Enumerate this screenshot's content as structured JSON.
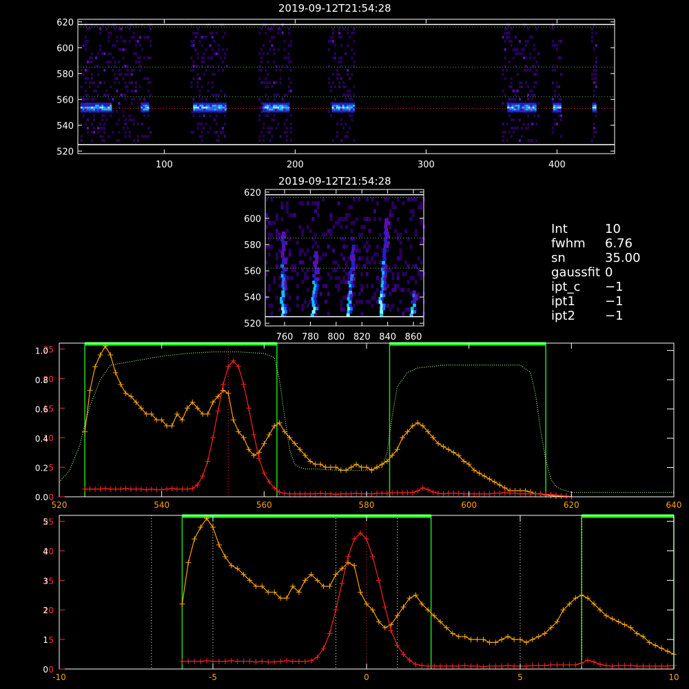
{
  "top_panel": {
    "title": "2019-09-12T21:54:28",
    "x_ticks": [
      100,
      200,
      300,
      400
    ],
    "y_ticks": [
      520,
      540,
      560,
      580,
      600,
      620
    ],
    "xlim": [
      34,
      444
    ],
    "ylim": [
      518,
      622
    ],
    "white_lines_y": [
      525,
      618
    ],
    "dotted_green_y": [
      562,
      585,
      616
    ],
    "dotted_red_y": [
      553
    ],
    "bright_row_y": 553,
    "stripes": [
      [
        36,
        90
      ],
      [
        120,
        148
      ],
      [
        172,
        196
      ],
      [
        225,
        245
      ],
      [
        358,
        386
      ],
      [
        396,
        403
      ],
      [
        426,
        430
      ]
    ],
    "bright_stripes": [
      [
        36,
        60
      ],
      [
        82,
        88
      ],
      [
        122,
        146
      ],
      [
        175,
        195
      ],
      [
        228,
        244
      ],
      [
        362,
        384
      ],
      [
        397,
        402
      ],
      [
        427,
        430
      ]
    ]
  },
  "zoom_panel": {
    "title": "2019-09-12T21:54:28",
    "x_ticks": [
      760,
      780,
      800,
      820,
      840,
      860
    ],
    "y_ticks": [
      520,
      540,
      560,
      580,
      600,
      620
    ],
    "xlim": [
      745,
      868
    ],
    "ylim": [
      518,
      622
    ],
    "white_lines_y": [
      525,
      618
    ],
    "dotted_green_y": [
      562,
      585,
      616
    ],
    "streaks": [
      [
        757,
        525,
        758,
        590
      ],
      [
        781,
        525,
        783,
        575
      ],
      [
        808,
        525,
        812,
        578
      ],
      [
        833,
        525,
        838,
        600
      ],
      [
        858,
        525,
        860,
        545
      ]
    ]
  },
  "info": [
    {
      "key": "Int",
      "value": "10"
    },
    {
      "key": "fwhm",
      "value": "6.76"
    },
    {
      "key": "sn",
      "value": "35.00"
    },
    {
      "key": "gaussfit",
      "value": "0"
    },
    {
      "key": "ipt_c",
      "value": "−1"
    },
    {
      "key": "ipt1",
      "value": "−1"
    },
    {
      "key": "ipt2",
      "value": "−1"
    }
  ],
  "chart_data": [
    {
      "type": "line",
      "xlim": [
        520,
        640
      ],
      "x_ticks": [
        520,
        540,
        560,
        580,
        600,
        620,
        640
      ],
      "left_red_axis": {
        "ylim": [
          0,
          26
        ],
        "ticks": [
          0,
          5,
          10,
          15,
          20,
          25
        ],
        "labels": [
          "0",
          "5",
          "10",
          "15",
          "20",
          "25"
        ]
      },
      "left_white_axis": {
        "ylim": [
          0,
          1.05
        ],
        "ticks": [
          0.0,
          0.2,
          0.4,
          0.6,
          0.8,
          1.0
        ],
        "labels": [
          "0.0",
          "0.2",
          "0.4",
          "0.6",
          "0.8",
          "1.0"
        ]
      },
      "green_windows": [
        [
          525,
          562.5
        ],
        [
          584.5,
          615
        ]
      ],
      "red_dotted_x": [
        553
      ],
      "series": [
        {
          "color": "#ffa500",
          "axis": "red",
          "x": [
            525,
            526,
            527,
            528,
            529,
            530,
            531,
            532,
            533,
            534,
            535,
            536,
            537,
            538,
            539,
            540,
            541,
            542,
            543,
            544,
            545,
            546,
            547,
            548,
            549,
            550,
            551,
            552,
            553,
            554,
            555,
            556,
            557,
            558,
            559,
            560,
            561,
            562,
            563,
            564,
            565,
            566,
            567,
            568,
            569,
            570,
            571,
            572,
            573,
            574,
            575,
            576,
            577,
            578,
            579,
            580,
            581,
            582,
            583,
            584,
            585,
            586,
            587,
            588,
            589,
            590,
            591,
            592,
            593,
            594,
            595,
            596,
            597,
            598,
            599,
            600,
            601,
            602,
            603,
            604,
            605,
            606,
            607,
            608,
            609,
            610,
            611,
            612,
            613,
            614,
            615,
            616,
            617,
            618,
            619,
            620
          ],
          "values": [
            11,
            18,
            22,
            24,
            25.5,
            24,
            21,
            19,
            17.5,
            17,
            16,
            15,
            14,
            14,
            13,
            13,
            12,
            12,
            14,
            13,
            15,
            16,
            15,
            14,
            14,
            16,
            17,
            18,
            17.5,
            13,
            11,
            10,
            8,
            7,
            7.5,
            9,
            10.5,
            12,
            12.5,
            11,
            10,
            9,
            8,
            7,
            6,
            5.5,
            5.5,
            5,
            5,
            5,
            4.5,
            4.5,
            5,
            5.5,
            5,
            5,
            4.5,
            5,
            5.5,
            6,
            7,
            8,
            10,
            11,
            12,
            12.5,
            12,
            11,
            10,
            9,
            8.5,
            8,
            7.5,
            7,
            6,
            5.5,
            4.5,
            4,
            3.5,
            3,
            2.5,
            2,
            1.5,
            1,
            1,
            1,
            1,
            0.8,
            0.5,
            0.5,
            0.3,
            0.2,
            0.1,
            0.1,
            0.1,
            0
          ]
        },
        {
          "color": "#ff2020",
          "axis": "red",
          "x": [
            525,
            526,
            527,
            528,
            529,
            530,
            531,
            532,
            533,
            534,
            535,
            536,
            537,
            538,
            539,
            540,
            541,
            542,
            543,
            544,
            545,
            546,
            547,
            548,
            549,
            550,
            551,
            552,
            553,
            554,
            555,
            556,
            557,
            558,
            559,
            560,
            561,
            562,
            563,
            564,
            565,
            566,
            567,
            568,
            569,
            570,
            571,
            572,
            573,
            574,
            575,
            576,
            577,
            578,
            579,
            580,
            581,
            582,
            583,
            584,
            585,
            586,
            587,
            588,
            589,
            590,
            591,
            592,
            593,
            594,
            595,
            596,
            597,
            598,
            599,
            600,
            601,
            602,
            603,
            604,
            605,
            606,
            607,
            608,
            609,
            610,
            611,
            612,
            613,
            614,
            615,
            616,
            617,
            618,
            619,
            620
          ],
          "values": [
            1.3,
            1.3,
            1.3,
            1.3,
            1.4,
            1.3,
            1.3,
            1.3,
            1.4,
            1.3,
            1.3,
            1.3,
            1.2,
            1.3,
            1.2,
            1.2,
            1.3,
            1.4,
            1.3,
            1.3,
            1.3,
            1.4,
            2,
            3.5,
            6,
            10,
            14.5,
            19,
            22,
            23,
            22,
            19,
            15,
            10.5,
            6.5,
            4,
            2.5,
            1.5,
            0.8,
            0.6,
            0.5,
            0.5,
            0.5,
            0.5,
            0.5,
            0.5,
            0.6,
            0.5,
            0.5,
            0.4,
            0.5,
            0.5,
            0.5,
            0.6,
            0.5,
            0.5,
            0.5,
            0.6,
            0.6,
            0.6,
            0.7,
            0.7,
            0.7,
            0.7,
            0.7,
            1,
            1.5,
            1.2,
            0.8,
            0.6,
            0.5,
            0.6,
            0.6,
            0.6,
            0.5,
            0.5,
            0.5,
            0.5,
            0.5,
            0.5,
            0.6,
            0.6,
            0.7,
            0.6,
            0.6,
            0.5,
            0.5,
            0.5,
            0.5,
            0.5,
            0.4,
            0.4,
            0.3,
            0.2,
            0.1,
            0
          ]
        },
        {
          "color": "#a8ff78",
          "axis": "white",
          "dotted": true,
          "x": [
            520,
            522,
            524,
            525,
            526,
            528,
            530,
            535,
            540,
            545,
            550,
            555,
            560,
            562,
            563,
            564,
            565,
            566,
            567,
            568,
            570,
            575,
            580,
            583,
            584,
            585,
            586,
            588,
            590,
            595,
            600,
            605,
            610,
            612,
            613,
            614,
            615,
            616,
            617,
            618,
            620,
            625,
            630,
            635,
            640
          ],
          "values": [
            0.1,
            0.18,
            0.35,
            0.5,
            0.62,
            0.8,
            0.9,
            0.93,
            0.96,
            0.98,
            0.99,
            0.99,
            0.98,
            0.95,
            0.8,
            0.55,
            0.32,
            0.22,
            0.2,
            0.19,
            0.19,
            0.18,
            0.18,
            0.2,
            0.3,
            0.55,
            0.75,
            0.85,
            0.88,
            0.9,
            0.9,
            0.9,
            0.9,
            0.85,
            0.7,
            0.45,
            0.25,
            0.12,
            0.07,
            0.05,
            0.03,
            0.03,
            0.03,
            0.03,
            0.03
          ]
        }
      ]
    },
    {
      "type": "line",
      "xlim": [
        -10,
        10
      ],
      "x_ticks": [
        -10,
        -5,
        0,
        5,
        10
      ],
      "left_red_axis": {
        "ylim": [
          0,
          26
        ],
        "ticks": [
          0,
          5,
          10,
          15,
          20,
          25
        ],
        "labels": [
          "0",
          "5",
          "10",
          "15",
          "20",
          "25"
        ]
      },
      "left_white_axis": {
        "ylim": [
          0,
          5.2
        ],
        "ticks": [
          0,
          1,
          2,
          3,
          4,
          5
        ],
        "labels": [
          "0",
          "1",
          "2",
          "3",
          "4",
          "5"
        ]
      },
      "green_windows": [
        [
          -6,
          2.1
        ],
        [
          7,
          10
        ]
      ],
      "white_dotted_x": [
        -7,
        -5,
        -1,
        1,
        5,
        7
      ],
      "red_dotted_x": [
        0
      ],
      "series": [
        {
          "color": "#ffa500",
          "x": [
            -6,
            -5.8,
            -5.6,
            -5.4,
            -5.2,
            -5,
            -4.8,
            -4.6,
            -4.4,
            -4.2,
            -4,
            -3.8,
            -3.6,
            -3.4,
            -3.2,
            -3,
            -2.8,
            -2.6,
            -2.4,
            -2.2,
            -2,
            -1.8,
            -1.6,
            -1.4,
            -1.2,
            -1,
            -0.8,
            -0.6,
            -0.4,
            -0.2,
            0,
            0.2,
            0.4,
            0.6,
            0.8,
            1,
            1.2,
            1.4,
            1.6,
            1.8,
            2,
            2.2,
            2.4,
            2.6,
            2.8,
            3,
            3.2,
            3.4,
            3.6,
            3.8,
            4,
            4.2,
            4.4,
            4.6,
            4.8,
            5,
            5.2,
            5.4,
            5.6,
            5.8,
            6,
            6.2,
            6.4,
            6.6,
            6.8,
            7,
            7.2,
            7.4,
            7.6,
            7.8,
            8,
            8.2,
            8.4,
            8.6,
            8.8,
            9,
            9.2,
            9.4,
            9.6,
            9.8,
            10
          ],
          "values": [
            11,
            18,
            22,
            24,
            25.5,
            24,
            21,
            19,
            17.5,
            17,
            16,
            15,
            14,
            14,
            13,
            13,
            12,
            12,
            14,
            13,
            15,
            16,
            15,
            14,
            14,
            16,
            17,
            18,
            17.5,
            13,
            11,
            10,
            8,
            7,
            7.5,
            9,
            10.5,
            12,
            12.5,
            11,
            10,
            9,
            8,
            7,
            6,
            5.5,
            5.5,
            5,
            5,
            5,
            4.5,
            4.5,
            5,
            5.5,
            5,
            5,
            4.5,
            5,
            5.5,
            6,
            7,
            8,
            10,
            11,
            12,
            12.5,
            12,
            11,
            10,
            9,
            8.5,
            8,
            7.5,
            7,
            6,
            5.5,
            4.5,
            4,
            3.5,
            3,
            2.5
          ]
        },
        {
          "color": "#ff2020",
          "x": [
            -6,
            -5.8,
            -5.6,
            -5.4,
            -5.2,
            -5,
            -4.8,
            -4.6,
            -4.4,
            -4.2,
            -4,
            -3.8,
            -3.6,
            -3.4,
            -3.2,
            -3,
            -2.8,
            -2.6,
            -2.4,
            -2.2,
            -2,
            -1.8,
            -1.6,
            -1.4,
            -1.2,
            -1,
            -0.8,
            -0.6,
            -0.4,
            -0.2,
            0,
            0.2,
            0.4,
            0.6,
            0.8,
            1,
            1.2,
            1.4,
            1.6,
            1.8,
            2,
            2.2,
            2.4,
            2.6,
            2.8,
            3,
            3.2,
            3.4,
            3.6,
            3.8,
            4,
            4.2,
            4.4,
            4.6,
            4.8,
            5,
            5.2,
            5.4,
            5.6,
            5.8,
            6,
            6.2,
            6.4,
            6.6,
            6.8,
            7,
            7.2,
            7.4,
            7.6,
            7.8,
            8,
            8.2,
            8.4,
            8.6,
            8.8,
            9,
            9.2,
            9.4,
            9.6,
            9.8,
            10
          ],
          "values": [
            1.3,
            1.3,
            1.3,
            1.3,
            1.4,
            1.3,
            1.3,
            1.3,
            1.4,
            1.3,
            1.3,
            1.3,
            1.2,
            1.3,
            1.2,
            1.2,
            1.3,
            1.4,
            1.3,
            1.3,
            1.3,
            1.4,
            2,
            3.5,
            6,
            10,
            14.5,
            19,
            22,
            23,
            22,
            19,
            15,
            10.5,
            6.5,
            4,
            2.5,
            1.5,
            0.8,
            0.6,
            0.5,
            0.5,
            0.5,
            0.5,
            0.5,
            0.5,
            0.6,
            0.5,
            0.5,
            0.4,
            0.5,
            0.5,
            0.5,
            0.6,
            0.5,
            0.5,
            0.5,
            0.6,
            0.6,
            0.6,
            0.7,
            0.7,
            0.7,
            0.7,
            0.7,
            1,
            1.5,
            1.2,
            0.8,
            0.6,
            0.5,
            0.6,
            0.6,
            0.6,
            0.5,
            0.5,
            0.5,
            0.5,
            0.5,
            0.5,
            0.6
          ]
        }
      ]
    }
  ]
}
